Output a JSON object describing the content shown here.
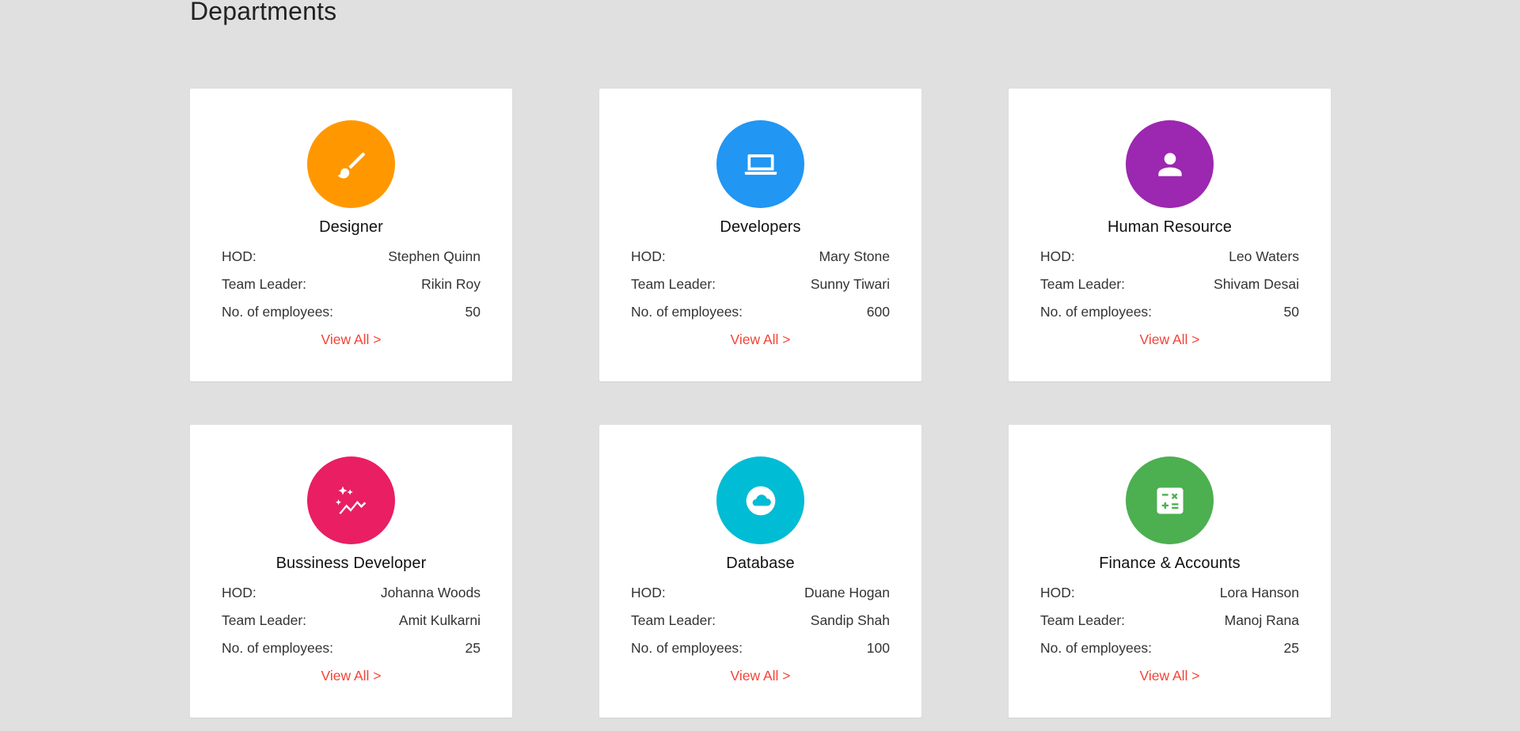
{
  "page_title": "Departments",
  "labels": {
    "hod": "HOD:",
    "team_leader": "Team Leader:",
    "employees": "No. of employees:",
    "view_all": "View All >"
  },
  "departments": [
    {
      "name": "Designer",
      "hod": "Stephen Quinn",
      "team_leader": "Rikin Roy",
      "employees": "50",
      "icon": "paintbrush-icon",
      "color": "#ff9800"
    },
    {
      "name": "Developers",
      "hod": "Mary Stone",
      "team_leader": "Sunny Tiwari",
      "employees": "600",
      "icon": "laptop-icon",
      "color": "#2196f3"
    },
    {
      "name": "Human Resource",
      "hod": "Leo Waters",
      "team_leader": "Shivam Desai",
      "employees": "50",
      "icon": "person-icon",
      "color": "#9c27b0"
    },
    {
      "name": "Bussiness Developer",
      "hod": "Johanna Woods",
      "team_leader": "Amit Kulkarni",
      "employees": "25",
      "icon": "sparkle-chart-icon",
      "color": "#e91e63"
    },
    {
      "name": "Database",
      "hod": "Duane Hogan",
      "team_leader": "Sandip Shah",
      "employees": "100",
      "icon": "cloud-icon",
      "color": "#00bcd4"
    },
    {
      "name": "Finance & Accounts",
      "hod": "Lora Hanson",
      "team_leader": "Manoj Rana",
      "employees": "25",
      "icon": "calculator-icon",
      "color": "#4caf50"
    }
  ]
}
